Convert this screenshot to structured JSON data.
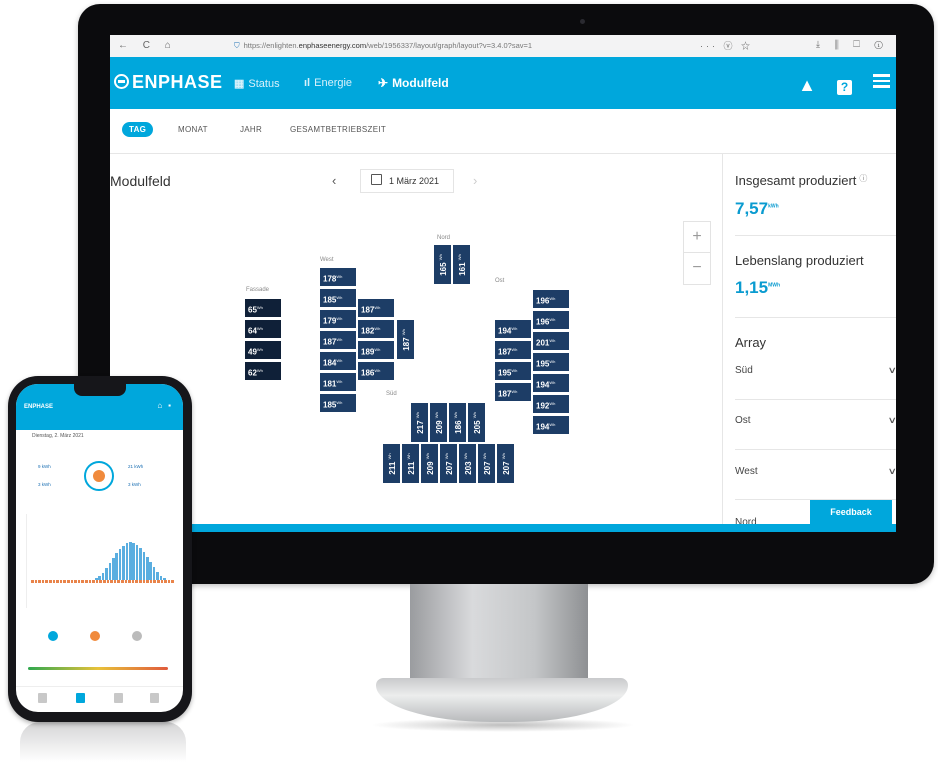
{
  "browser": {
    "nav_icons": "← C ⌂",
    "url_prefix": "https://enlighten.",
    "url_domain": "enphaseenergy.com",
    "url_suffix": "/web/1956337/layout/graph/layout?v=3.4.0?sav=1",
    "right_icons": "··· ⓥ ☆",
    "toolbar_icons": "⤓ ⫼ ☐ ⓘ"
  },
  "app": {
    "logo": "ENPHASE",
    "nav": [
      {
        "icon": "▦",
        "label": "Status"
      },
      {
        "icon": "ıl",
        "label": "Energie"
      },
      {
        "icon": "✈",
        "label": "Modulfeld"
      }
    ],
    "header_icons": [
      "bell-icon",
      "help-icon",
      "menu-icon"
    ],
    "help_glyph": "?",
    "bell_glyph": "▲"
  },
  "tabs": [
    "TAG",
    "MONAT",
    "JAHR",
    "GESAMTBETRIEBSZEIT"
  ],
  "main": {
    "title": "Modulfeld",
    "prev": "‹",
    "next": "›",
    "date": "1 März 2021",
    "zoom_in": "+",
    "zoom_out": "−",
    "array_labels": {
      "fassade": "Fassade",
      "west": "West",
      "nord": "Nord",
      "ost": "Ost",
      "sued": "Süd"
    },
    "unit": "Wh",
    "modules": {
      "fassade": [
        "65",
        "64",
        "49",
        "62"
      ],
      "west_col1": [
        "178",
        "185",
        "179",
        "187",
        "184",
        "181",
        "185"
      ],
      "west_col2": [
        "187",
        "182",
        "189",
        "186"
      ],
      "west_vertical": "187",
      "nord": [
        "165",
        "161"
      ],
      "ost_col1": [
        "194",
        "187",
        "195",
        "187"
      ],
      "ost_col2": [
        "196",
        "196",
        "201",
        "195",
        "194",
        "192",
        "194"
      ],
      "sued_top": [
        "217",
        "209",
        "186",
        "205"
      ],
      "sued_bottom": [
        "211",
        "211",
        "209",
        "207",
        "203",
        "207",
        "207"
      ]
    }
  },
  "panel": {
    "total_title": "Insgesamt produziert",
    "total_value": "7,57",
    "total_unit": "kWh",
    "life_title": "Lebenslang produziert",
    "life_value": "1,15",
    "life_unit": "MWh",
    "array_title": "Array",
    "arrays": [
      "Süd",
      "Ost",
      "West",
      "Nord"
    ],
    "feedback": "Feedback"
  },
  "phone": {
    "logo": "ENPHASE",
    "date": "Dienstag, 2. März 2021",
    "stats": [
      "9 kWh",
      "21 kWh",
      "3 kWh",
      "3 kWh"
    ],
    "bars": [
      0.05,
      0.1,
      0.18,
      0.3,
      0.42,
      0.55,
      0.68,
      0.78,
      0.86,
      0.92,
      0.95,
      0.93,
      0.88,
      0.8,
      0.7,
      0.58,
      0.45,
      0.32,
      0.2,
      0.1,
      0.05
    ],
    "legend_colors": [
      "#00a7dc",
      "#f08a3c",
      "#bbbbbb"
    ]
  }
}
